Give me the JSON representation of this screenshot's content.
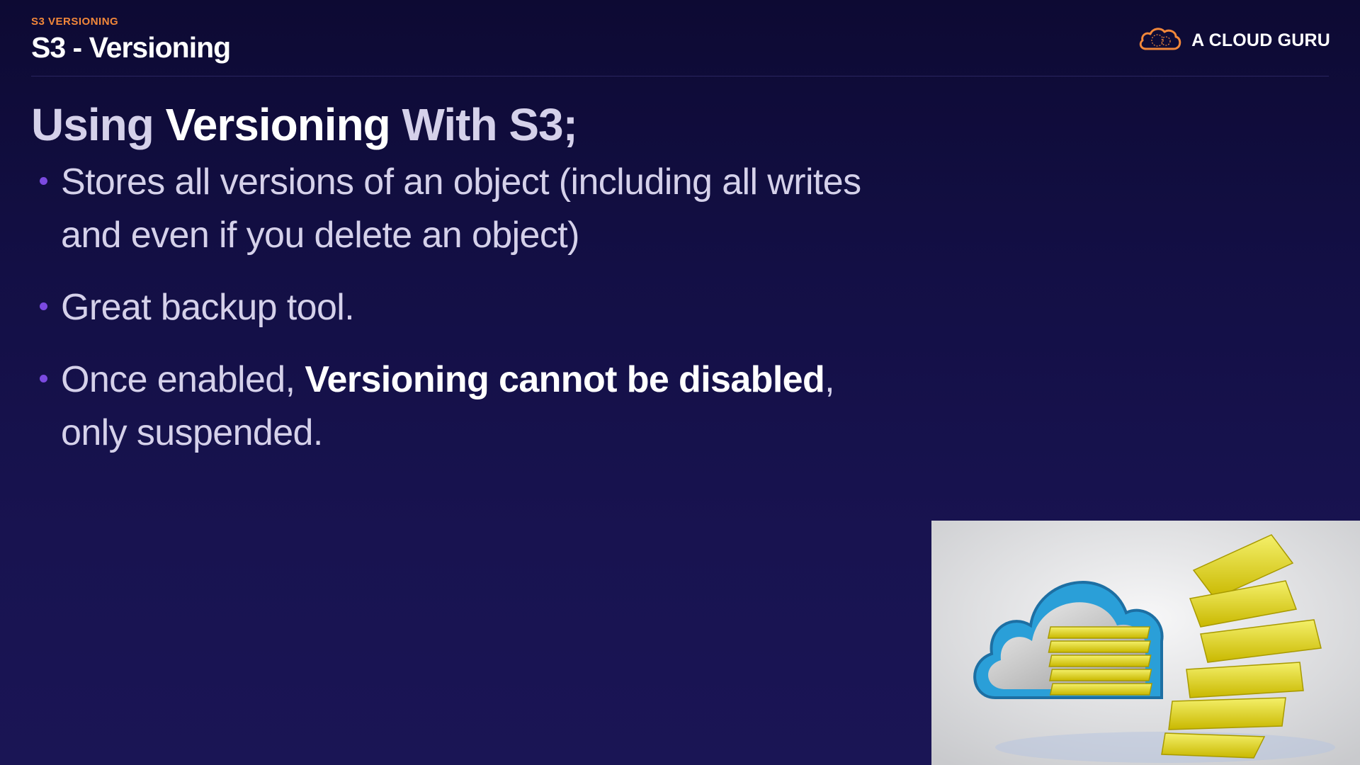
{
  "header": {
    "eyebrow": "S3 VERSIONING",
    "title": "S3 - Versioning"
  },
  "brand": {
    "name": "A CLOUD GURU",
    "logo_icon": "cloud-logo-icon",
    "accent_color": "#f2873a"
  },
  "slide": {
    "heading": {
      "prefix": "Using ",
      "emphasis": "Versioning",
      "suffix": " With S3;"
    },
    "bullets": [
      {
        "line1": "Stores all versions of an object (including all writes",
        "line2": "and even if you delete an object)"
      },
      {
        "text": "Great backup tool."
      },
      {
        "prefix": "Once enabled, ",
        "emphasis": "Versioning cannot be disabled",
        "suffix": ",",
        "line2": "only suspended."
      }
    ]
  },
  "colors": {
    "background_top": "#0d0a33",
    "background_bottom": "#1a1555",
    "bullet_dot": "#7b4ae0",
    "body_text": "#d5d1ea"
  },
  "illustration": {
    "icon": "cloud-with-folders-illustration"
  }
}
